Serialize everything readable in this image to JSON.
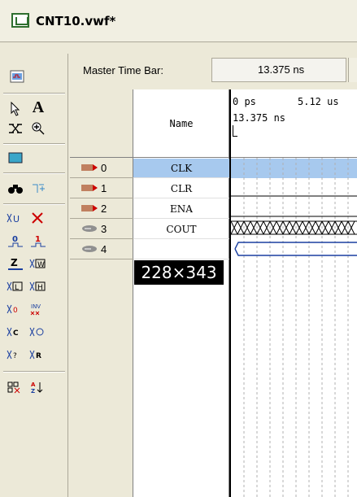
{
  "window": {
    "title": "CNT10.vwf*"
  },
  "header": {
    "master_time_bar_label": "Master Time Bar:",
    "master_time_bar_value": "13.375 ns"
  },
  "grid": {
    "name_header": "Name",
    "ruler": {
      "start": "0 ps",
      "mark": "5.12 us",
      "cursor_time": "13.375 ns"
    },
    "rows": [
      {
        "index": "0",
        "name": "CLK",
        "pin_type": "input",
        "selected": true
      },
      {
        "index": "1",
        "name": "CLR",
        "pin_type": "input",
        "selected": false
      },
      {
        "index": "2",
        "name": "ENA",
        "pin_type": "input",
        "selected": false
      },
      {
        "index": "3",
        "name": "COUT",
        "pin_type": "output",
        "selected": false
      },
      {
        "index": "4",
        "name": "",
        "pin_type": "bus-output",
        "selected": false
      }
    ]
  },
  "overlay_label": "228×343",
  "toolbar": {
    "tools": [
      "waveform-editor-icon",
      "selection-tool-icon",
      "text-tool-icon",
      "waveform-editing-tool-icon",
      "zoom-tool-icon",
      "full-screen-icon",
      "find-icon",
      "replace-icon",
      "uninitialized-icon",
      "dont-care-icon",
      "forcing-low-icon",
      "forcing-high-icon",
      "high-impedance-icon",
      "weak-unknown-icon",
      "weak-low-icon",
      "weak-high-icon",
      "invert-icon",
      "count-value-icon",
      "clock-icon",
      "arbitrary-value-icon",
      "random-value-icon",
      "snap-to-grid-icon",
      "sort-icon"
    ]
  }
}
